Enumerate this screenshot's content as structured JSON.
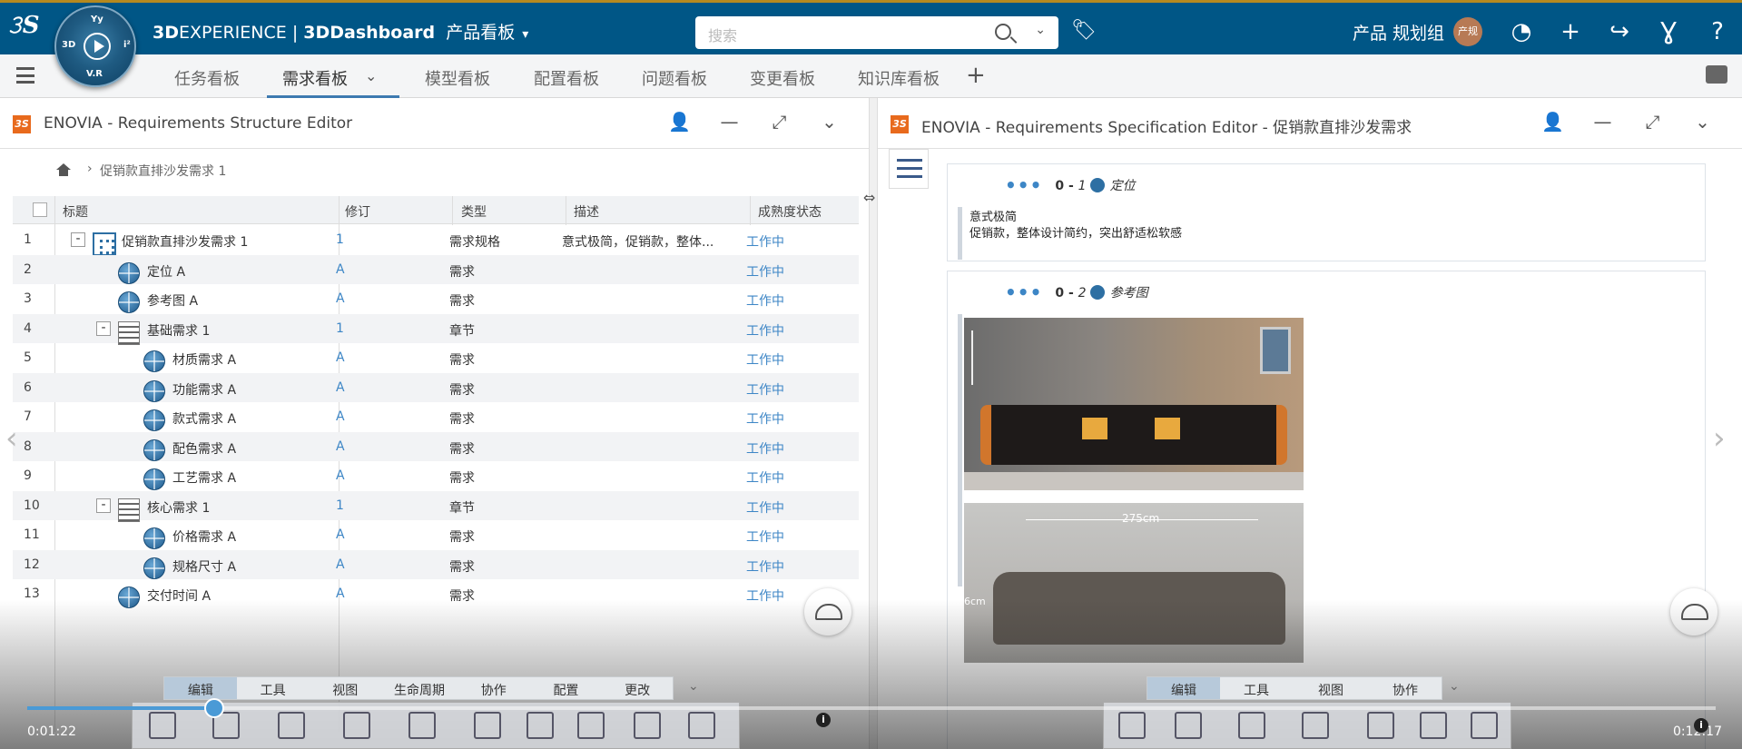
{
  "topbar": {
    "brand_bold": "3D",
    "brand_rest": "EXPERIENCE | ",
    "app_bold": "3DDashboard",
    "dashboard_name": "产品看板",
    "compass_version": "V.R",
    "search_placeholder": "搜索",
    "user_label": "产品 规划组",
    "avatar_text": "产规",
    "brand_color": "#005686"
  },
  "tabs": [
    {
      "label": "任务看板"
    },
    {
      "label": "需求看板",
      "active": true
    },
    {
      "label": "模型看板"
    },
    {
      "label": "配置看板"
    },
    {
      "label": "问题看板"
    },
    {
      "label": "变更看板"
    },
    {
      "label": "知识库看板"
    }
  ],
  "left_panel": {
    "logo": "3S",
    "title": "ENOVIA - Requirements Structure Editor",
    "breadcrumb": "促销款直排沙发需求 1",
    "columns": [
      "标题",
      "修订",
      "类型",
      "描述",
      "成熟度状态"
    ],
    "rows": [
      {
        "n": "1",
        "title": "促销款直排沙发需求 1",
        "rev": "1",
        "type": "需求规格",
        "desc": "意式极简，促销款，整体...",
        "maturity": "工作中"
      },
      {
        "n": "2",
        "title": "定位 A",
        "rev": "A",
        "type": "需求",
        "desc": "",
        "maturity": "工作中"
      },
      {
        "n": "3",
        "title": "参考图 A",
        "rev": "A",
        "type": "需求",
        "desc": "",
        "maturity": "工作中"
      },
      {
        "n": "4",
        "title": "基础需求 1",
        "rev": "1",
        "type": "章节",
        "desc": "",
        "maturity": "工作中"
      },
      {
        "n": "5",
        "title": "材质需求 A",
        "rev": "A",
        "type": "需求",
        "desc": "",
        "maturity": "工作中"
      },
      {
        "n": "6",
        "title": "功能需求 A",
        "rev": "A",
        "type": "需求",
        "desc": "",
        "maturity": "工作中"
      },
      {
        "n": "7",
        "title": "款式需求 A",
        "rev": "A",
        "type": "需求",
        "desc": "",
        "maturity": "工作中"
      },
      {
        "n": "8",
        "title": "配色需求 A",
        "rev": "A",
        "type": "需求",
        "desc": "",
        "maturity": "工作中"
      },
      {
        "n": "9",
        "title": "工艺需求 A",
        "rev": "A",
        "type": "需求",
        "desc": "",
        "maturity": "工作中"
      },
      {
        "n": "10",
        "title": "核心需求 1",
        "rev": "1",
        "type": "章节",
        "desc": "",
        "maturity": "工作中"
      },
      {
        "n": "11",
        "title": "价格需求 A",
        "rev": "A",
        "type": "需求",
        "desc": "",
        "maturity": "工作中"
      },
      {
        "n": "12",
        "title": "规格尺寸 A",
        "rev": "A",
        "type": "需求",
        "desc": "",
        "maturity": "工作中"
      },
      {
        "n": "13",
        "title": "交付时间 A",
        "rev": "A",
        "type": "需求",
        "desc": "",
        "maturity": "工作中"
      }
    ],
    "action_tabs": [
      "编辑",
      "工具",
      "视图",
      "生命周期",
      "协作",
      "配置",
      "更改"
    ]
  },
  "right_panel": {
    "logo": "3S",
    "title": "ENOVIA - Requirements Specification Editor - 促销款直排沙发需求",
    "sections": [
      {
        "prefix": "0 - ",
        "num": "1",
        "name": "定位",
        "body_line1": "意式极简",
        "body_line2": "促销款，整体设计简约，突出舒适松软感"
      },
      {
        "prefix": "0 - ",
        "num": "2",
        "name": "参考图"
      }
    ],
    "image_dimension_label": "275cm",
    "image_side_label": "6cm",
    "action_tabs": [
      "编辑",
      "工具",
      "视图",
      "协作"
    ]
  },
  "player": {
    "elapsed": "0:01:22",
    "total": "0:12:17",
    "progress_fraction": 0.111
  }
}
